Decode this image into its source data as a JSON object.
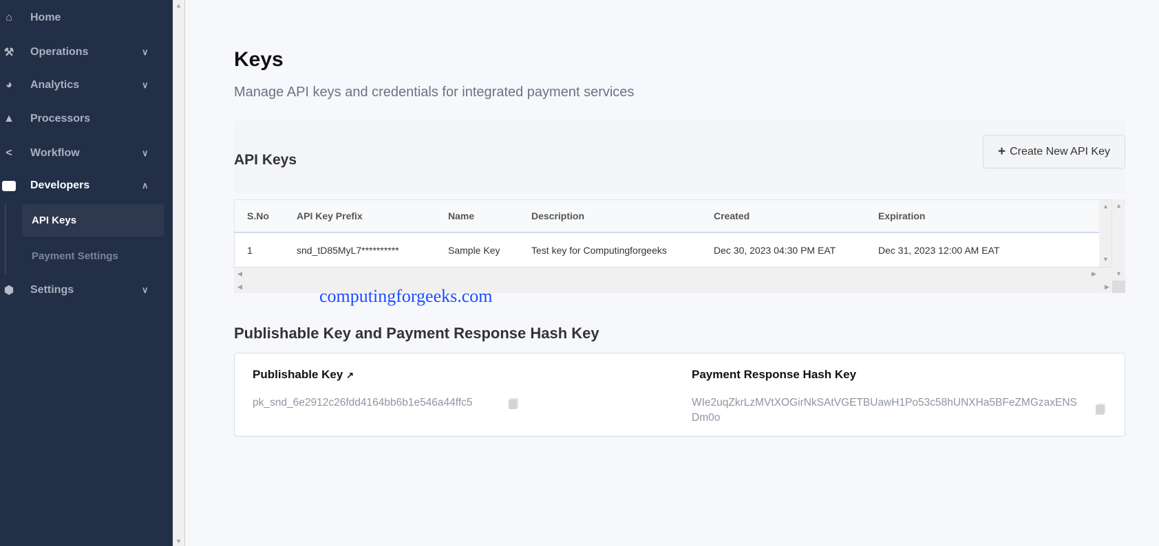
{
  "sidebar": {
    "items": [
      {
        "label": "Home",
        "icon": "home-icon"
      },
      {
        "label": "Operations",
        "icon": "tools-icon"
      },
      {
        "label": "Analytics",
        "icon": "pie-chart-icon"
      },
      {
        "label": "Processors",
        "icon": "shapes-icon"
      },
      {
        "label": "Workflow",
        "icon": "share-icon"
      },
      {
        "label": "Developers",
        "icon": "monitor-icon"
      },
      {
        "label": "Settings",
        "icon": "gear-icon"
      }
    ],
    "sub_items": [
      {
        "label": "API Keys"
      },
      {
        "label": "Payment Settings"
      }
    ]
  },
  "page": {
    "title": "Keys",
    "subtitle": "Manage API keys and credentials for integrated payment services"
  },
  "api_keys": {
    "title": "API Keys",
    "create_label": "Create New API Key",
    "columns": [
      "S.No",
      "API Key Prefix",
      "Name",
      "Description",
      "Created",
      "Expiration"
    ],
    "rows": [
      [
        "1",
        "snd_tD85MyL7**********",
        "Sample Key",
        "Test key for Computingforgeeks",
        "Dec 30, 2023 04:30 PM EAT",
        "Dec 31, 2023 12:00 AM EAT"
      ]
    ]
  },
  "watermark": "computingforgeeks.com",
  "keys_section": {
    "title": "Publishable Key and Payment Response Hash Key",
    "publishable_label": "Publishable Key",
    "publishable_value": "pk_snd_6e2912c26fdd4164bb6b1e546a44ffc5",
    "hash_label": "Payment Response Hash Key",
    "hash_value": "WIe2uqZkrLzMVtXOGirNkSAtVGETBUawH1Po53c58hUNXHa5BFeZMGzaxENSDm0o"
  },
  "colors": {
    "sidebar": "#232f47",
    "accent": "#1a4cff"
  }
}
